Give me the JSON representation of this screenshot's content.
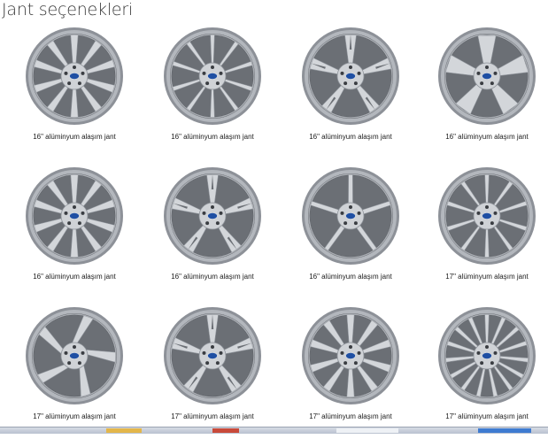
{
  "page_title": "Jant seçenekleri",
  "wheels": [
    {
      "caption": "16\" alüminyum alaşım jant",
      "style": "multi-y",
      "spokes": 10
    },
    {
      "caption": "16\" alüminyum alaşım jant",
      "style": "thin-double",
      "spokes": 10
    },
    {
      "caption": "16\" alüminyum alaşım jant",
      "style": "split-y",
      "spokes": 5
    },
    {
      "caption": "16\" alüminyum alaşım jant",
      "style": "blade",
      "spokes": 5
    },
    {
      "caption": "16\" alüminyum alaşım jant",
      "style": "multi-y",
      "spokes": 10
    },
    {
      "caption": "16\" alüminyum alaşım jant",
      "style": "split-y",
      "spokes": 5
    },
    {
      "caption": "16\" alüminyum alaşım jant",
      "style": "star",
      "spokes": 5
    },
    {
      "caption": "17\" alüminyum alaşım jant",
      "style": "thin-double",
      "spokes": 10
    },
    {
      "caption": "17\" alüminyum alaşım jant",
      "style": "swirl",
      "spokes": 5
    },
    {
      "caption": "17\" alüminyum alaşım jant",
      "style": "split-y",
      "spokes": 5
    },
    {
      "caption": "17\" alüminyum alaşım jant",
      "style": "multi-y",
      "spokes": 10
    },
    {
      "caption": "17\" alüminyum alaşım jant",
      "style": "thin-double",
      "spokes": 15
    }
  ],
  "colors": {
    "rim_outer": "#8d9198",
    "rim_face": "#c9ccd1",
    "spoke": "#d3d6da",
    "spoke_edge": "#8e939a",
    "hub_logo": "#1f4fa3"
  }
}
